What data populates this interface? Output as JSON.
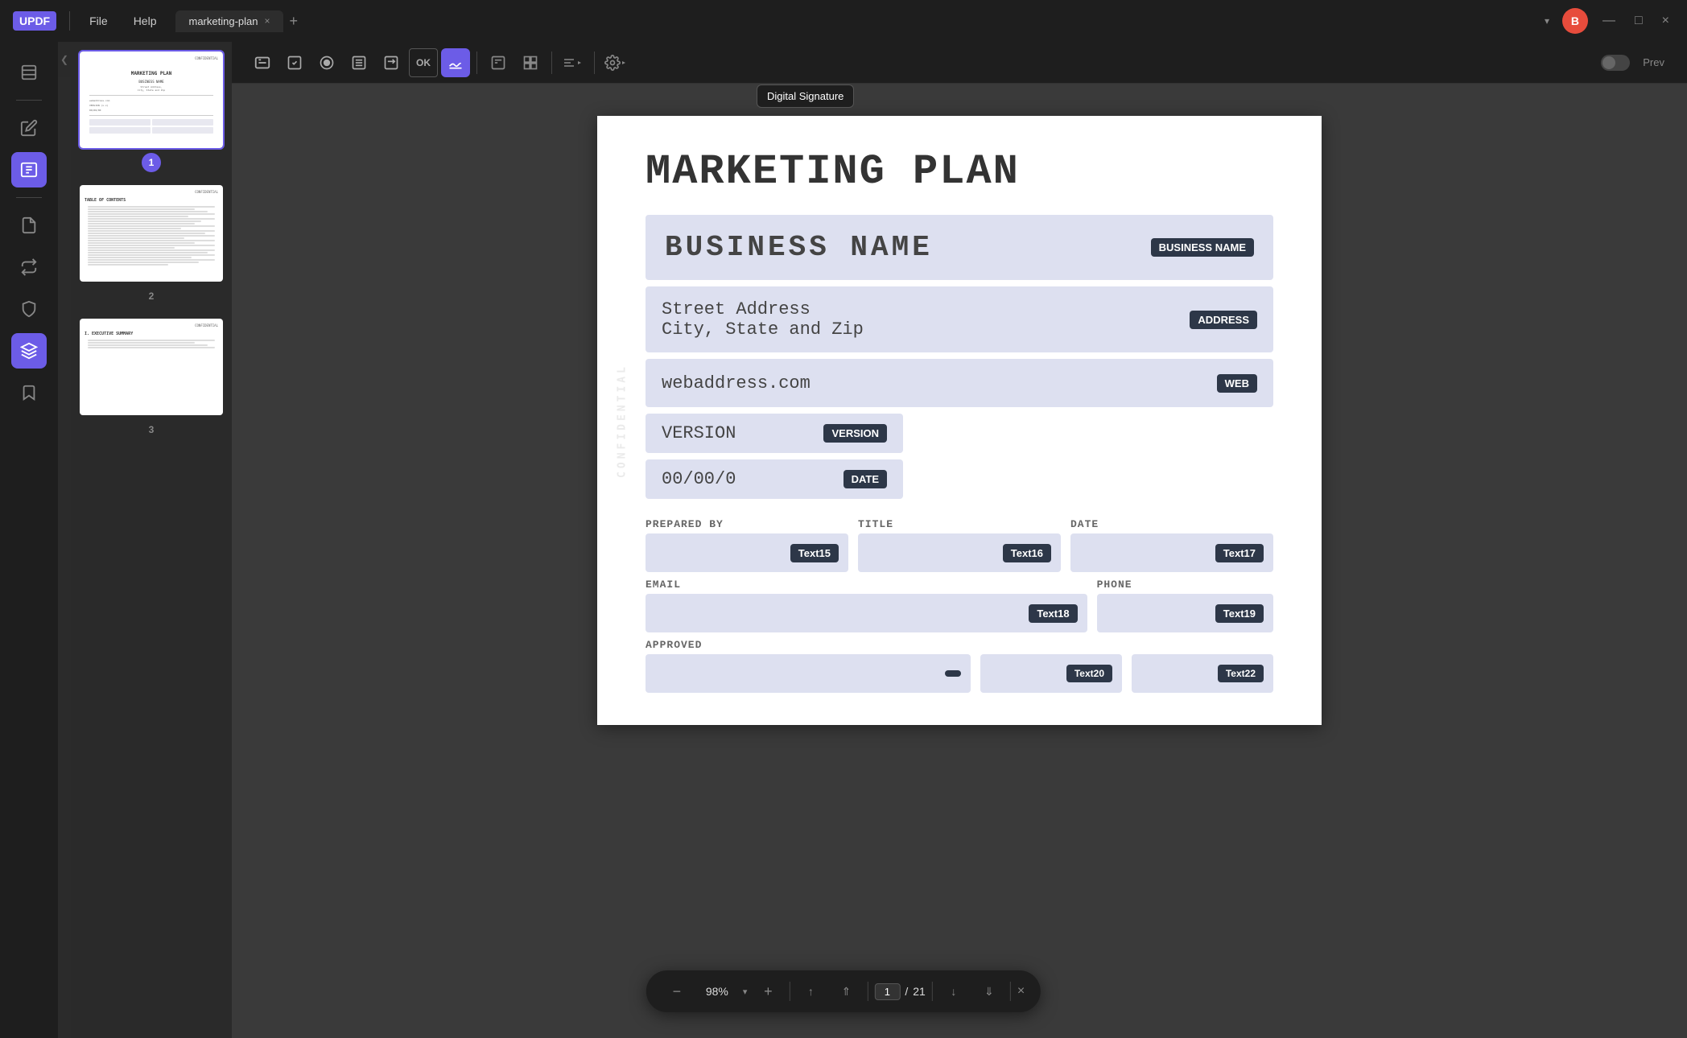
{
  "app": {
    "name": "UPDF",
    "logo": "UPDF"
  },
  "titlebar": {
    "file_menu": "File",
    "help_menu": "Help",
    "tab_name": "marketing-plan",
    "tab_close": "×",
    "tab_add": "+",
    "tab_dropdown": "▾",
    "user_initial": "B",
    "minimize": "—",
    "maximize": "□",
    "close": "×"
  },
  "toolbar": {
    "buttons": [
      {
        "id": "text",
        "icon": "T",
        "label": "Text"
      },
      {
        "id": "checkbox",
        "icon": "☑",
        "label": "Checkbox"
      },
      {
        "id": "radio",
        "icon": "⊙",
        "label": "Radio"
      },
      {
        "id": "list",
        "icon": "≡",
        "label": "List"
      },
      {
        "id": "combo",
        "icon": "▤",
        "label": "Combo"
      },
      {
        "id": "button",
        "icon": "OK",
        "label": "Button"
      },
      {
        "id": "signature",
        "icon": "✍",
        "label": "Digital Signature",
        "active": true
      }
    ],
    "sep1": true,
    "layout_btn": "⊞",
    "align_btn": "≡",
    "settings_btn": "⚙",
    "prev_label": "Prev",
    "toggle_off": true
  },
  "tooltip": {
    "label": "Digital Signature",
    "visible": true
  },
  "sidebar": {
    "icons": [
      {
        "id": "pages",
        "icon": "📋",
        "label": "Pages"
      },
      {
        "id": "sep1"
      },
      {
        "id": "pen",
        "icon": "✏",
        "label": "Edit"
      },
      {
        "id": "form",
        "icon": "📊",
        "label": "Form",
        "active": true
      },
      {
        "id": "sep2"
      },
      {
        "id": "organize",
        "icon": "📄",
        "label": "Organize"
      },
      {
        "id": "convert",
        "icon": "🔄",
        "label": "Convert"
      },
      {
        "id": "protect",
        "icon": "🛡",
        "label": "Protect"
      },
      {
        "id": "layers",
        "icon": "⊕",
        "label": "Layers"
      },
      {
        "id": "bookmark",
        "icon": "🔖",
        "label": "Bookmark"
      }
    ]
  },
  "thumbnails": [
    {
      "number": 1,
      "active": true,
      "label": "1",
      "confidential": "CONFIDENTIAL",
      "title": "MARKETING PLAN"
    },
    {
      "number": 2,
      "active": false,
      "label": "2",
      "confidential": "CONFIDENTIAL",
      "title": "TABLE OF CONTENTS"
    },
    {
      "number": 3,
      "active": false,
      "label": "3",
      "confidential": "CONFIDENTIAL",
      "title": "EXECUTIVE SUMMARY"
    }
  ],
  "document": {
    "title": "MARKETING PLAN",
    "confidential_watermark": "CONFIDENTIAL",
    "business_name": {
      "text": "BUSINESS NAME",
      "tag": "BUSINESS NAME"
    },
    "address": {
      "line1": "Street Address",
      "line2": "City, State and Zip",
      "tag": "ADDRESS"
    },
    "web": {
      "text": "webaddress.com",
      "tag": "WEB"
    },
    "version": {
      "text": "VERSION",
      "tag": "VERSION"
    },
    "date": {
      "text": "00/00/0",
      "tag": "DATE"
    },
    "prepared_by": {
      "label": "PREPARED BY",
      "tag": "Text15"
    },
    "title_field": {
      "label": "TITLE",
      "tag": "Text16"
    },
    "date_field": {
      "label": "DATE",
      "tag": "Text17"
    },
    "email": {
      "label": "EMAIL",
      "tag": "Text18"
    },
    "phone": {
      "label": "PHONE",
      "tag": "Text19"
    },
    "approved": {
      "label": "APPROVED"
    }
  },
  "nav_bar": {
    "zoom_out": "−",
    "zoom_level": "98%",
    "zoom_dropdown": "▾",
    "zoom_in": "+",
    "first_page": "⇑",
    "prev_page": "↑",
    "page_input": "1",
    "page_sep": "/",
    "total_pages": "21",
    "next_page": "↓",
    "last_page": "⇓",
    "close": "×"
  },
  "colors": {
    "accent": "#6c5ce7",
    "field_bg": "#dde0f0",
    "tag_bg": "#2d3748",
    "doc_bg": "#3a3a3a",
    "toolbar_bg": "#1e1e1e"
  }
}
